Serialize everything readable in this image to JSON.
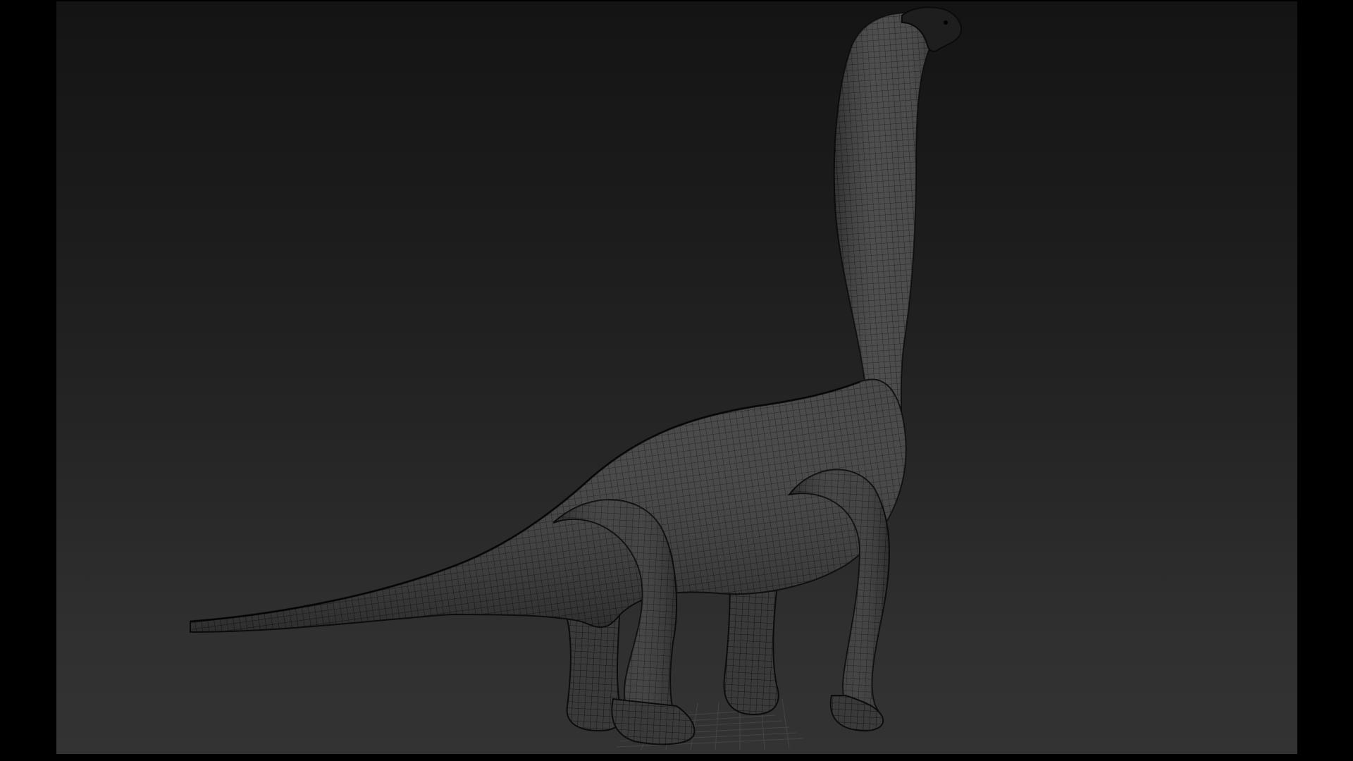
{
  "viewport": {
    "background_top": "#141414",
    "background_bottom": "#333333",
    "letterbox_color": "#000000"
  },
  "model": {
    "icon": "brachiosaurus-wireframe-mesh",
    "mesh_color": "#3c3c3c",
    "wire_color": "#141414",
    "floor_grid": true
  }
}
